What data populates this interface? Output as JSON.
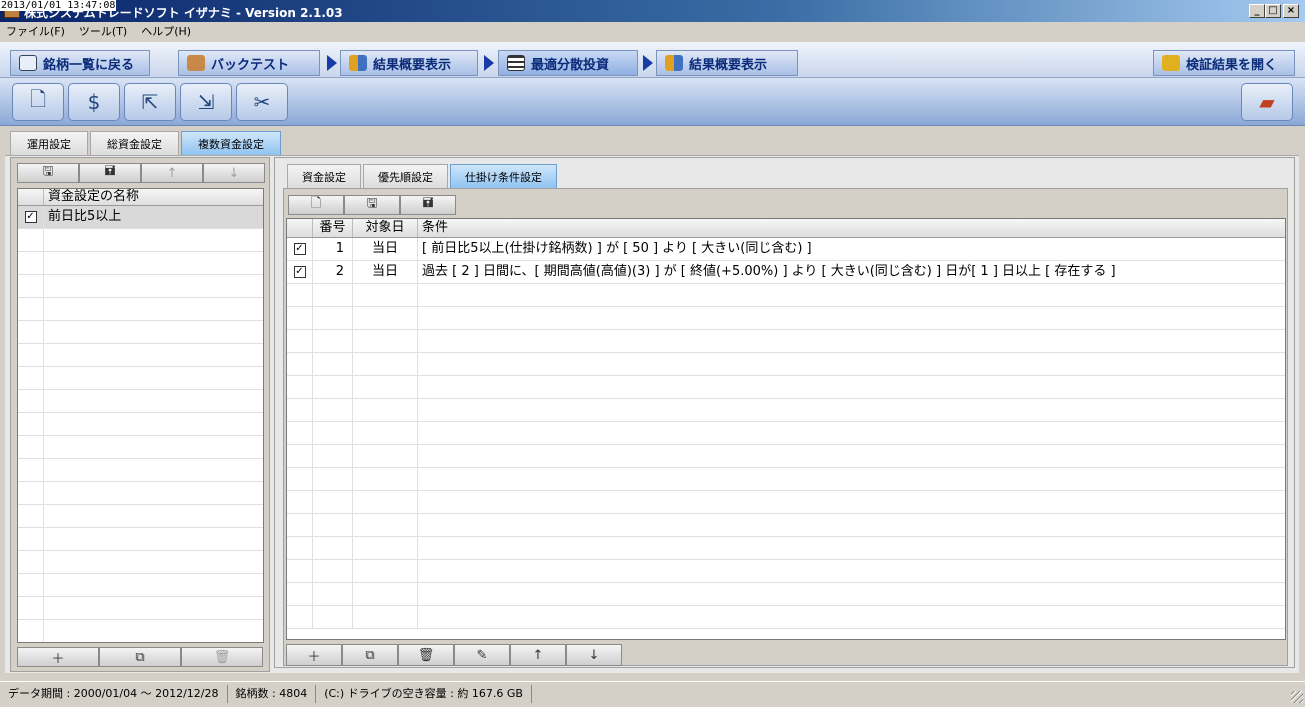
{
  "window": {
    "timestamp": "2013/01/01 13:47:08",
    "title": "株式システムトレードソフト イザナミ - Version 2.1.03",
    "min_label": "_",
    "max_label": "□",
    "close_label": "×"
  },
  "menu": {
    "file": "ファイル(F)",
    "tools": "ツール(T)",
    "help": "ヘルプ(H)"
  },
  "nav": {
    "back": "銘柄一覧に戻る",
    "backtest": "バックテスト",
    "summary1": "結果概要表示",
    "optimal": "最適分散投資",
    "summary2": "結果概要表示",
    "open_results": "検証結果を開く"
  },
  "outer_tabs": [
    "運用設定",
    "総資金設定",
    "複数資金設定"
  ],
  "left_panel": {
    "header": "資金設定の名称",
    "rows": [
      {
        "checked": "✓",
        "name": "前日比5以上"
      }
    ]
  },
  "inner_tabs": [
    "資金設定",
    "優先順設定",
    "仕掛け条件設定"
  ],
  "conditions": {
    "headers": {
      "no": "番号",
      "target": "対象日",
      "condition": "条件"
    },
    "rows": [
      {
        "checked": "✓",
        "no": "1",
        "target": "当日",
        "condition": "[ 前日比5以上(仕掛け銘柄数) ] が [ 50 ] より [ 大きい(同じ含む) ]"
      },
      {
        "checked": "✓",
        "no": "2",
        "target": "当日",
        "condition": "過去 [ 2 ] 日間に、[ 期間高値(高値)(3) ] が [ 終値(+5.00%) ] より [ 大きい(同じ含む) ] 日が[ 1 ] 日以上 [ 存在する ]"
      }
    ]
  },
  "status": {
    "period": "データ期間 : 2000/01/04 〜 2012/12/28",
    "count": "銘柄数 : 4804",
    "drive": "(C:) ドライブの空き容量 : 約 167.6 GB"
  },
  "colors": {
    "title_bar": "#0a246a",
    "nav_text": "#0a2a7a",
    "active_tab": "#8fc3f0",
    "selected_row": "#d9d9d9"
  },
  "icons": {
    "nav_back": "eye-icon",
    "nav_backtest": "bag-icon",
    "nav_summary": "chart-icon",
    "nav_optimal": "grid-icon",
    "nav_open": "folder-icon",
    "toolbar": [
      "new-document-icon",
      "money-icon",
      "export-icon",
      "import-icon",
      "tools-icon",
      "exit-icon"
    ],
    "grid_tools": [
      "save-icon",
      "save-as-icon",
      "arrow-up-icon",
      "arrow-down-icon"
    ],
    "grid_bottom": [
      "add-icon",
      "copy-icon",
      "trash-icon",
      "edit-icon",
      "arrow-up-icon",
      "arrow-down-icon"
    ]
  }
}
